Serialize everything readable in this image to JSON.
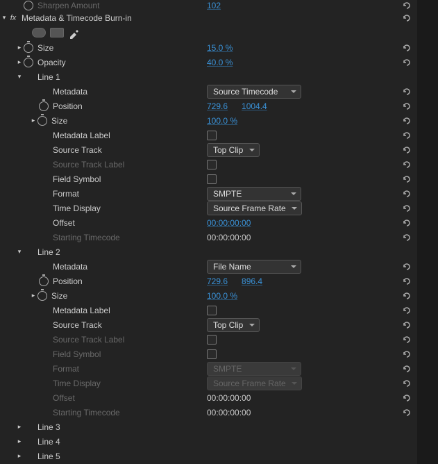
{
  "colors": {
    "accent": "#3a92d8"
  },
  "topEffect": {
    "label": "Sharpen Amount",
    "value": "102"
  },
  "effect": {
    "title": "Metadata & Timecode Burn-in",
    "size": {
      "label": "Size",
      "value": "15.0 %"
    },
    "opacity": {
      "label": "Opacity",
      "value": "40.0 %"
    },
    "line1": {
      "title": "Line 1",
      "metadata": {
        "label": "Metadata",
        "value": "Source Timecode"
      },
      "position": {
        "label": "Position",
        "x": "729.6",
        "y": "1004.4"
      },
      "size": {
        "label": "Size",
        "value": "100.0 %"
      },
      "metadataLabel": {
        "label": "Metadata Label"
      },
      "sourceTrack": {
        "label": "Source Track",
        "value": "Top Clip"
      },
      "sourceTrackLabel": {
        "label": "Source Track Label"
      },
      "fieldSymbol": {
        "label": "Field Symbol"
      },
      "format": {
        "label": "Format",
        "value": "SMPTE"
      },
      "timeDisplay": {
        "label": "Time Display",
        "value": "Source Frame Rate"
      },
      "offset": {
        "label": "Offset",
        "value": "00:00:00:00"
      },
      "startingTimecode": {
        "label": "Starting Timecode",
        "value": "00:00:00:00"
      }
    },
    "line2": {
      "title": "Line 2",
      "metadata": {
        "label": "Metadata",
        "value": "File Name"
      },
      "position": {
        "label": "Position",
        "x": "729.6",
        "y": "896.4"
      },
      "size": {
        "label": "Size",
        "value": "100.0 %"
      },
      "metadataLabel": {
        "label": "Metadata Label"
      },
      "sourceTrack": {
        "label": "Source Track",
        "value": "Top Clip"
      },
      "sourceTrackLabel": {
        "label": "Source Track Label"
      },
      "fieldSymbol": {
        "label": "Field Symbol"
      },
      "format": {
        "label": "Format",
        "value": "SMPTE"
      },
      "timeDisplay": {
        "label": "Time Display",
        "value": "Source Frame Rate"
      },
      "offset": {
        "label": "Offset",
        "value": "00:00:00:00"
      },
      "startingTimecode": {
        "label": "Starting Timecode",
        "value": "00:00:00:00"
      }
    },
    "line3": {
      "title": "Line 3"
    },
    "line4": {
      "title": "Line 4"
    },
    "line5": {
      "title": "Line 5"
    }
  }
}
